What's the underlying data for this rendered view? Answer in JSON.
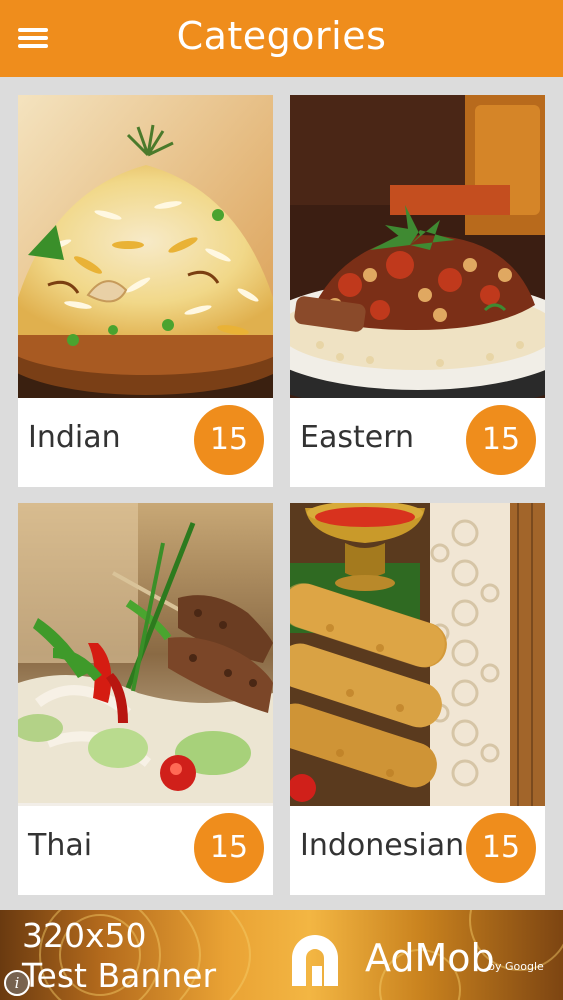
{
  "app_bar": {
    "title": "Categories",
    "menu_icon": "hamburger-menu-icon",
    "background": "#ef8d1c"
  },
  "categories": [
    {
      "name": "Indian",
      "count": "15",
      "image": "indian-biryani-photo"
    },
    {
      "name": "Eastern",
      "count": "15",
      "image": "eastern-meat-couscous-photo"
    },
    {
      "name": "Thai",
      "count": "15",
      "image": "thai-satay-salad-photo"
    },
    {
      "name": "Indonesian",
      "count": "15",
      "image": "indonesian-spring-rolls-photo"
    }
  ],
  "ad": {
    "size_text": "320x50",
    "label_text": "Test Banner",
    "brand": "AdMob",
    "by": "by Google",
    "info_icon": "info-icon"
  }
}
